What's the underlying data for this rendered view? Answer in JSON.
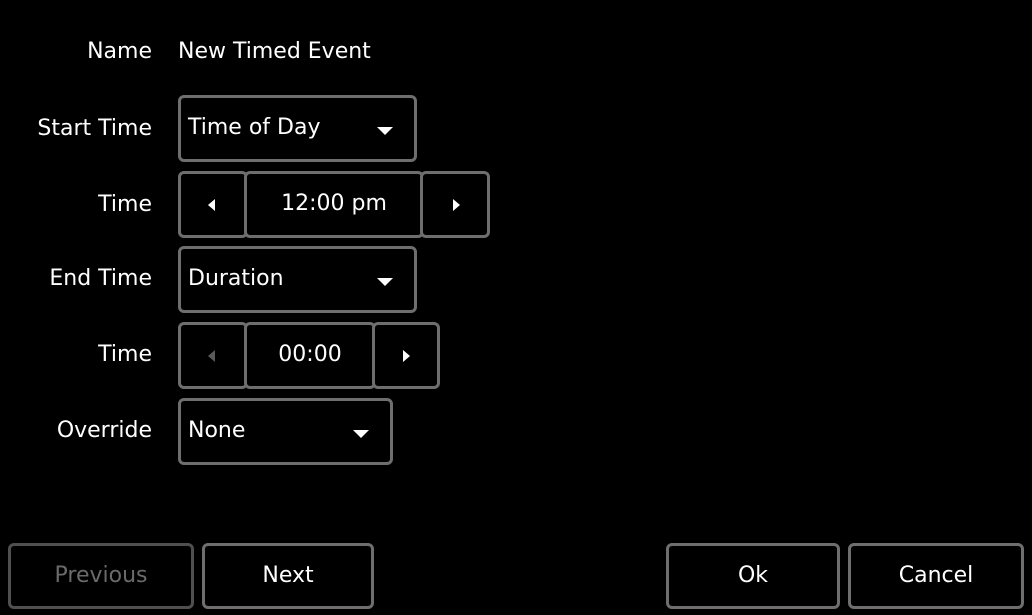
{
  "form": {
    "name": {
      "label": "Name",
      "value": "New Timed Event"
    },
    "start_time": {
      "label": "Start Time",
      "selected": "Time of Day"
    },
    "start_time_value": {
      "label": "Time",
      "value": "12:00 pm"
    },
    "end_time": {
      "label": "End Time",
      "selected": "Duration"
    },
    "duration_value": {
      "label": "Time",
      "value": "00:00"
    },
    "override": {
      "label": "Override",
      "selected": "None"
    }
  },
  "buttons": {
    "previous": "Previous",
    "next": "Next",
    "ok": "Ok",
    "cancel": "Cancel"
  },
  "icons": {
    "dropdown": "chevron-down-icon",
    "decrement": "arrow-left-icon",
    "increment": "arrow-right-icon"
  },
  "colors": {
    "background": "#000000",
    "text": "#ffffff",
    "border": "#6e6e6e",
    "disabled_text": "#6a6a6a"
  }
}
